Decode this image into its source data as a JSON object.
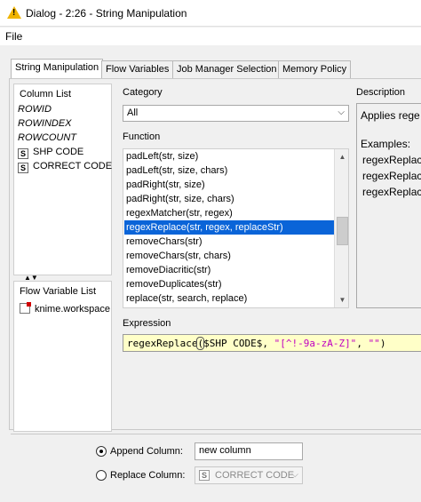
{
  "window": {
    "title": "Dialog - 2:26 - String Manipulation"
  },
  "menu": {
    "file": "File"
  },
  "tabs": [
    "String Manipulation",
    "Flow Variables",
    "Job Manager Selection",
    "Memory Policy"
  ],
  "column_list": {
    "header": "Column List",
    "items": [
      {
        "label": "ROWID",
        "kind": "special"
      },
      {
        "label": "ROWINDEX",
        "kind": "special"
      },
      {
        "label": "ROWCOUNT",
        "kind": "special"
      },
      {
        "label": "SHP CODE",
        "kind": "string",
        "icon": "S"
      },
      {
        "label": "CORRECT CODE",
        "kind": "string",
        "icon": "S"
      }
    ]
  },
  "flow_variable_list": {
    "header": "Flow Variable List",
    "items": [
      {
        "label": "knime.workspace"
      }
    ]
  },
  "category": {
    "label": "Category",
    "value": "All"
  },
  "function": {
    "label": "Function",
    "items": [
      "padLeft(str, size)",
      "padLeft(str, size, chars)",
      "padRight(str, size)",
      "padRight(str, size, chars)",
      "regexMatcher(str, regex)",
      "regexReplace(str, regex, replaceStr)",
      "removeChars(str)",
      "removeChars(str, chars)",
      "removeDiacritic(str)",
      "removeDuplicates(str)",
      "replace(str, search, replace)"
    ],
    "selected_index": 5
  },
  "description": {
    "label": "Description",
    "text": "Applies rege",
    "examples_label": "Examples:",
    "examples": [
      "regexReplac",
      "regexReplac",
      "regexReplac"
    ]
  },
  "expression": {
    "label": "Expression",
    "fn": "regexReplace",
    "open": "(",
    "column": "$SHP CODE$",
    "sep1": ", ",
    "regex": "\"[^!-9a-zA-Z]\"",
    "sep2": ", ",
    "repl": "\"\"",
    "close": ")"
  },
  "output": {
    "append_label": "Append Column:",
    "append_value": "new column",
    "append_selected": true,
    "replace_label": "Replace Column:",
    "replace_value": "CORRECT CODE",
    "replace_icon": "S"
  },
  "colors": {
    "selection": "#0a64d8",
    "expression_bg": "#ffffc8",
    "string_literal": "#c000c0"
  },
  "icons": {
    "title": "warning-triangle-icon",
    "column_type": "string-type-icon",
    "flow_var": "flow-variable-icon"
  }
}
